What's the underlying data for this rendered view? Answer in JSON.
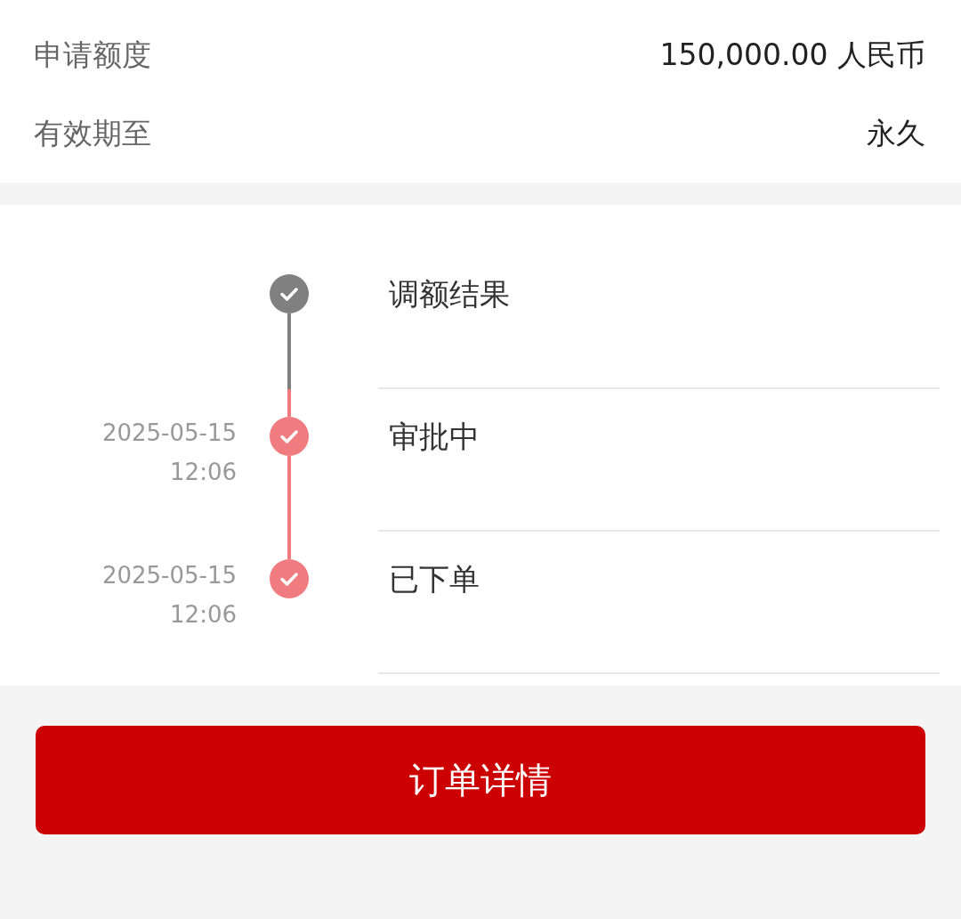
{
  "details": [
    {
      "label": "申请额度",
      "value": "150,000.00 人民币"
    },
    {
      "label": "有效期至",
      "value": "永久"
    }
  ],
  "steps": [
    {
      "title": "调额结果",
      "done": false
    },
    {
      "title": "审批中",
      "date": "2025-05-15",
      "time": "12:06",
      "done": true
    },
    {
      "title": "已下单",
      "date": "2025-05-15",
      "time": "12:06",
      "done": true
    }
  ],
  "button": {
    "label": "订单详情"
  }
}
